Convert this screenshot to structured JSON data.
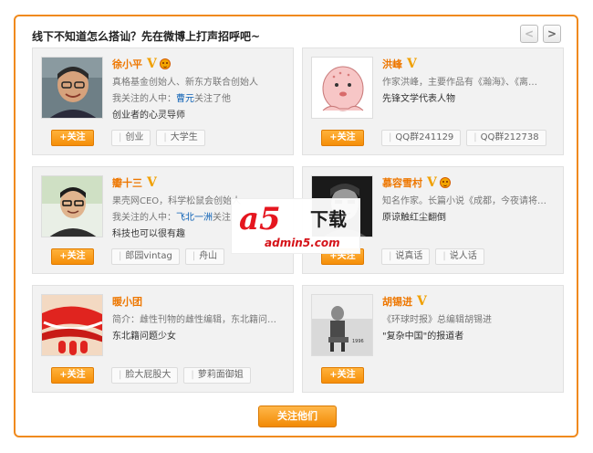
{
  "header": {
    "title": "线下不知道怎么搭讪？先在微博上打声招呼吧~",
    "prev_icon": "<",
    "next_icon": ">"
  },
  "follow_label": "+关注",
  "cards": [
    {
      "name": "徐小平",
      "verified_icon": "V",
      "has_face_icon": true,
      "desc": "真格基金创始人、新东方联合创始人",
      "rel_prefix": "我关注的人中：",
      "rel_link": "曹元",
      "rel_suffix": "关注了他",
      "tagline": "创业者的心灵导师",
      "chips": [
        "创业",
        "大学生"
      ]
    },
    {
      "name": "洪峰",
      "verified_icon": "V",
      "has_face_icon": false,
      "desc": "作家洪峰，主要作品有《瀚海》、《离…",
      "rel_prefix": "先锋文学代表人物",
      "rel_link": "",
      "rel_suffix": "",
      "tagline": "",
      "chips": [
        "QQ群241129",
        "QQ群212738"
      ]
    },
    {
      "name": "瓣十三",
      "verified_icon": "V",
      "has_face_icon": false,
      "desc": "果壳网CEO，科学松鼠会创始人",
      "rel_prefix": "我关注的人中：",
      "rel_link": "飞北一洲",
      "rel_suffix": "关注",
      "tagline": "科技也可以很有趣",
      "chips": [
        "郎园vintag",
        "舟山"
      ]
    },
    {
      "name": "慕容雪村",
      "verified_icon": "V",
      "has_face_icon": true,
      "desc": "知名作家。长篇小说《成都，今夜请将…",
      "rel_prefix": "原谅触红尘翻倒",
      "rel_link": "",
      "rel_suffix": "",
      "tagline": "",
      "chips": [
        "说真话",
        "说人话"
      ]
    },
    {
      "name": "暖小团",
      "verified_icon": "",
      "has_face_icon": false,
      "desc": "简介：雌性刊物的雌性编辑，东北籍问…",
      "rel_prefix": "东北籍问题少女",
      "rel_link": "",
      "rel_suffix": "",
      "tagline": "",
      "chips": [
        "脸大屁股大",
        "萝莉面御姐"
      ]
    },
    {
      "name": "胡锡进",
      "verified_icon": "V",
      "has_face_icon": false,
      "desc": "《环球时报》总编辑胡锡进",
      "rel_prefix": "\"复杂中国\"的报道者",
      "rel_link": "",
      "rel_suffix": "",
      "tagline": "",
      "chips": []
    }
  ],
  "footer": {
    "follow_all_label": "关注他们"
  },
  "watermark": {
    "logo": "a5",
    "cn": "下载",
    "url": "admin5.com"
  },
  "colors": {
    "accent": "#f08a1d",
    "name": "#ee7700",
    "link": "#0a5fb4",
    "watermark": "#e5161f"
  }
}
